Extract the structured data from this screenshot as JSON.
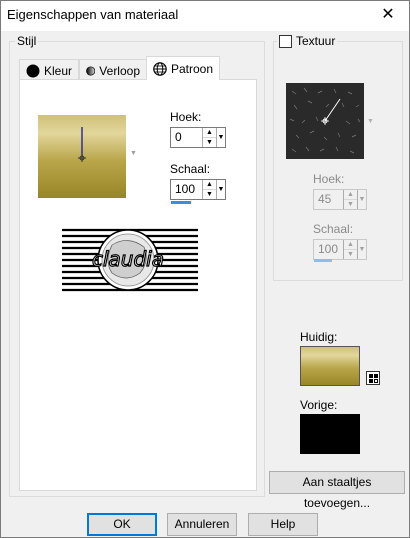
{
  "window": {
    "title": "Eigenschappen van materiaal",
    "close_glyph": "✕"
  },
  "stijl": {
    "label": "Stijl",
    "tabs": [
      {
        "label": "Kleur",
        "icon": "black-circle-icon"
      },
      {
        "label": "Verloop",
        "icon": "gradient-circle-icon"
      },
      {
        "label": "Patroon",
        "icon": "pattern-globe-icon",
        "active": true
      }
    ],
    "hoek": {
      "label": "Hoek:",
      "value": "0"
    },
    "schaal": {
      "label": "Schaal:",
      "value": "100"
    },
    "preview_logo": "claudia"
  },
  "textuur": {
    "label": "Textuur",
    "checked": false,
    "hoek": {
      "label": "Hoek:",
      "value": "45"
    },
    "schaal": {
      "label": "Schaal:",
      "value": "100"
    }
  },
  "huidig": {
    "label": "Huidig:"
  },
  "vorige": {
    "label": "Vorige:"
  },
  "buttons": {
    "add_to_swatches": "Aan staaltjes toevoegen...",
    "ok": "OK",
    "cancel": "Annuleren",
    "help": "Help"
  },
  "colors": {
    "gold_light": "#e2d69c",
    "gold_dark": "#978628",
    "accent": "#0078d7",
    "previous_swatch": "#000000"
  }
}
